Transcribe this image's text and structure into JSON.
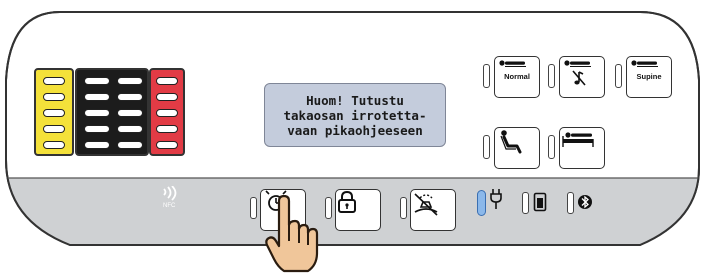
{
  "lcd": {
    "line1": "Huom! Tutustu",
    "line2": "takaosan irrotetta-",
    "line3": "vaan pikaohjeeseen"
  },
  "mode_buttons": {
    "normal_label": "Normal",
    "supine_label": "Supine"
  },
  "nfc": {
    "label": "NFC",
    "icon": "nfc-signal-icon"
  },
  "led_columns": {
    "yellow": {
      "color": "#f4e13a",
      "rows": 5
    },
    "black": {
      "color": "#1c1c1c",
      "rows": 5
    },
    "red": {
      "color": "#e23b45",
      "rows": 5
    }
  },
  "status_icons": [
    "power-plug-icon",
    "battery-icon",
    "bluetooth-icon"
  ],
  "colors": {
    "panel_bottom": "#cfd1d3",
    "lcd": "#c4ccdc",
    "indicator_active": "#8bb8ea"
  }
}
